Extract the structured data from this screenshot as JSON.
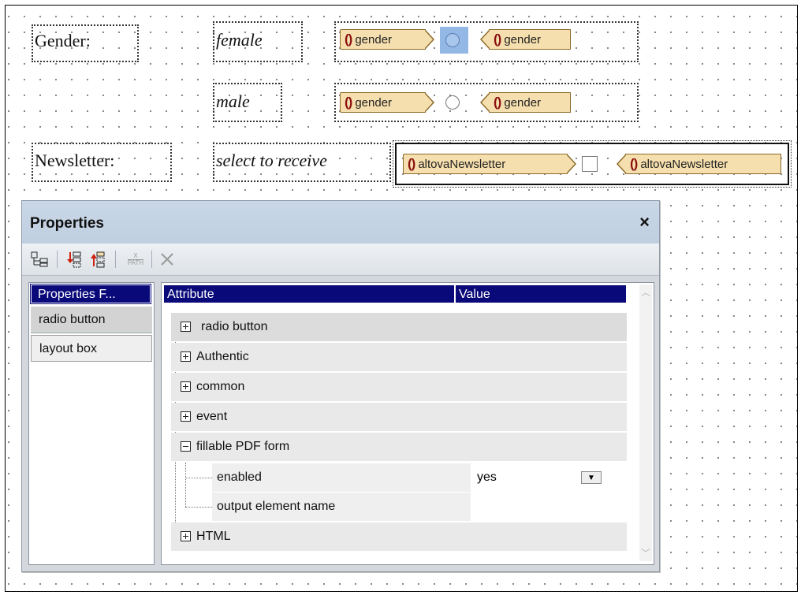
{
  "form": {
    "gender_label": "Gender:",
    "female_label": "female",
    "male_label": "male",
    "newsletter_label": "Newsletter:",
    "newsletter_hint": "select to receive",
    "gender_tag": "gender",
    "newsletter_tag": "altovaNewsletter"
  },
  "properties": {
    "title": "Properties",
    "close_glyph": "×",
    "toolbar": {
      "xpath_label_top": "X",
      "xpath_label_bottom": "PATH"
    },
    "for_header": "Properties F...",
    "for_items": [
      "radio button",
      "layout box"
    ],
    "columns": {
      "attribute": "Attribute",
      "value": "Value"
    },
    "groups": [
      {
        "label": "radio button",
        "expanded": false
      },
      {
        "label": "Authentic",
        "expanded": false
      },
      {
        "label": "common",
        "expanded": false
      },
      {
        "label": "event",
        "expanded": false
      },
      {
        "label": "fillable PDF form",
        "expanded": true
      },
      {
        "label": "HTML",
        "expanded": false
      }
    ],
    "pdf_attributes": [
      {
        "name": "enabled",
        "value": "yes"
      },
      {
        "name": "output element name",
        "value": ""
      }
    ]
  }
}
